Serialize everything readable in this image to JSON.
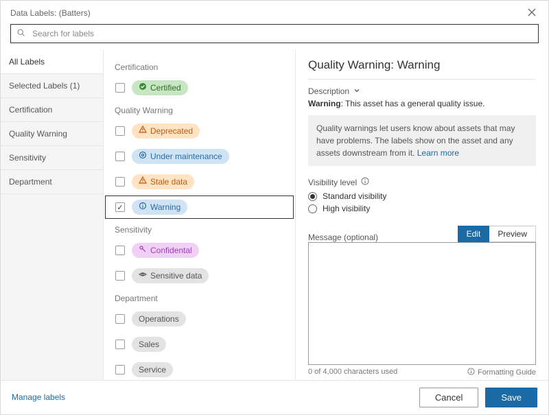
{
  "title": "Data Labels: (Batters)",
  "search": {
    "placeholder": "Search for labels"
  },
  "sidebar": {
    "all": "All Labels",
    "items": [
      "Selected Labels (1)",
      "Certification",
      "Quality Warning",
      "Sensitivity",
      "Department"
    ]
  },
  "groups": {
    "certification": {
      "header": "Certification",
      "items": [
        {
          "label": "Certified",
          "checked": false
        }
      ]
    },
    "quality": {
      "header": "Quality Warning",
      "items": [
        {
          "label": "Deprecated",
          "checked": false
        },
        {
          "label": "Under maintenance",
          "checked": false
        },
        {
          "label": "Stale data",
          "checked": false
        },
        {
          "label": "Warning",
          "checked": true
        }
      ]
    },
    "sensitivity": {
      "header": "Sensitivity",
      "items": [
        {
          "label": "Confidental",
          "checked": false
        },
        {
          "label": "Sensitive data",
          "checked": false
        }
      ]
    },
    "department": {
      "header": "Department",
      "items": [
        {
          "label": "Operations",
          "checked": false
        },
        {
          "label": "Sales",
          "checked": false
        },
        {
          "label": "Service",
          "checked": false
        }
      ]
    }
  },
  "detail": {
    "title": "Quality Warning: Warning",
    "desc_toggle": "Description",
    "desc_bold": "Warning",
    "desc_rest": ": This asset has a general quality issue.",
    "info_text": "Quality warnings let users know about assets that may have problems. The labels show on the asset and any assets downstream from it. ",
    "learn_more": "Learn more",
    "vis_label": "Visibility level",
    "vis_standard": "Standard visibility",
    "vis_high": "High visibility",
    "msg_label": "Message (optional)",
    "tab_edit": "Edit",
    "tab_preview": "Preview",
    "char_count": "0 of 4,000 characters used",
    "formatting_guide": "Formatting Guide"
  },
  "footer": {
    "manage": "Manage labels",
    "cancel": "Cancel",
    "save": "Save"
  }
}
